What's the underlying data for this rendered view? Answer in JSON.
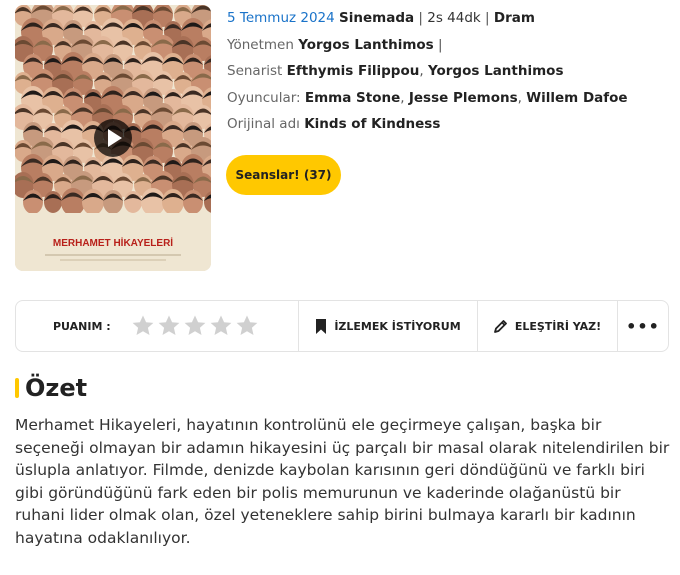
{
  "movie": {
    "release_date": "5 Temmuz 2024",
    "status": "Sinemada",
    "duration": "2s 44dk",
    "genre": "Dram",
    "director_label": "Yönetmen",
    "director": "Yorgos Lanthimos",
    "writer_label": "Senarist",
    "writers": [
      "Efthymis Filippou",
      "Yorgos Lanthimos"
    ],
    "cast_label": "Oyuncular:",
    "cast": [
      "Emma Stone",
      "Jesse Plemons",
      "Willem Dafoe"
    ],
    "original_title_label": "Orijinal adı",
    "original_title": "Kinds of Kindness",
    "sessions_button": "Seanslar! (37)"
  },
  "poster": {
    "title": "MERHAMET HİKAYELERİ",
    "bg_color": "#efe6d2",
    "title_color": "#b8201a",
    "play_icon": "play-icon"
  },
  "actions": {
    "rating_label": "PUANIM :",
    "rating_value": 0,
    "rating_max": 5,
    "watchlist_label": "İZLEMEK İSTİYORUM",
    "review_label": "ELEŞTİRİ YAZ!",
    "more_label": "•••"
  },
  "summary": {
    "title": "Özet",
    "text": "Merhamet Hikayeleri, hayatının kontrolünü ele geçirmeye çalışan, başka bir seçeneği olmayan bir adamın hikayesini üç parçalı bir masal olarak nitelendirilen bir üslupla anlatıyor. Filmde, denizde kaybolan karısının geri döndüğünü ve farklı biri gibi göründüğünü fark eden bir polis memurunun ve kaderinde olağanüstü bir ruhani lider olmak olan, özel yeteneklere sahip birini bulmaya kararlı bir kadının hayatına odaklanılıyor."
  },
  "colors": {
    "accent": "#ffc800",
    "link": "#1a73c9",
    "star_empty": "#d0d0d0"
  }
}
